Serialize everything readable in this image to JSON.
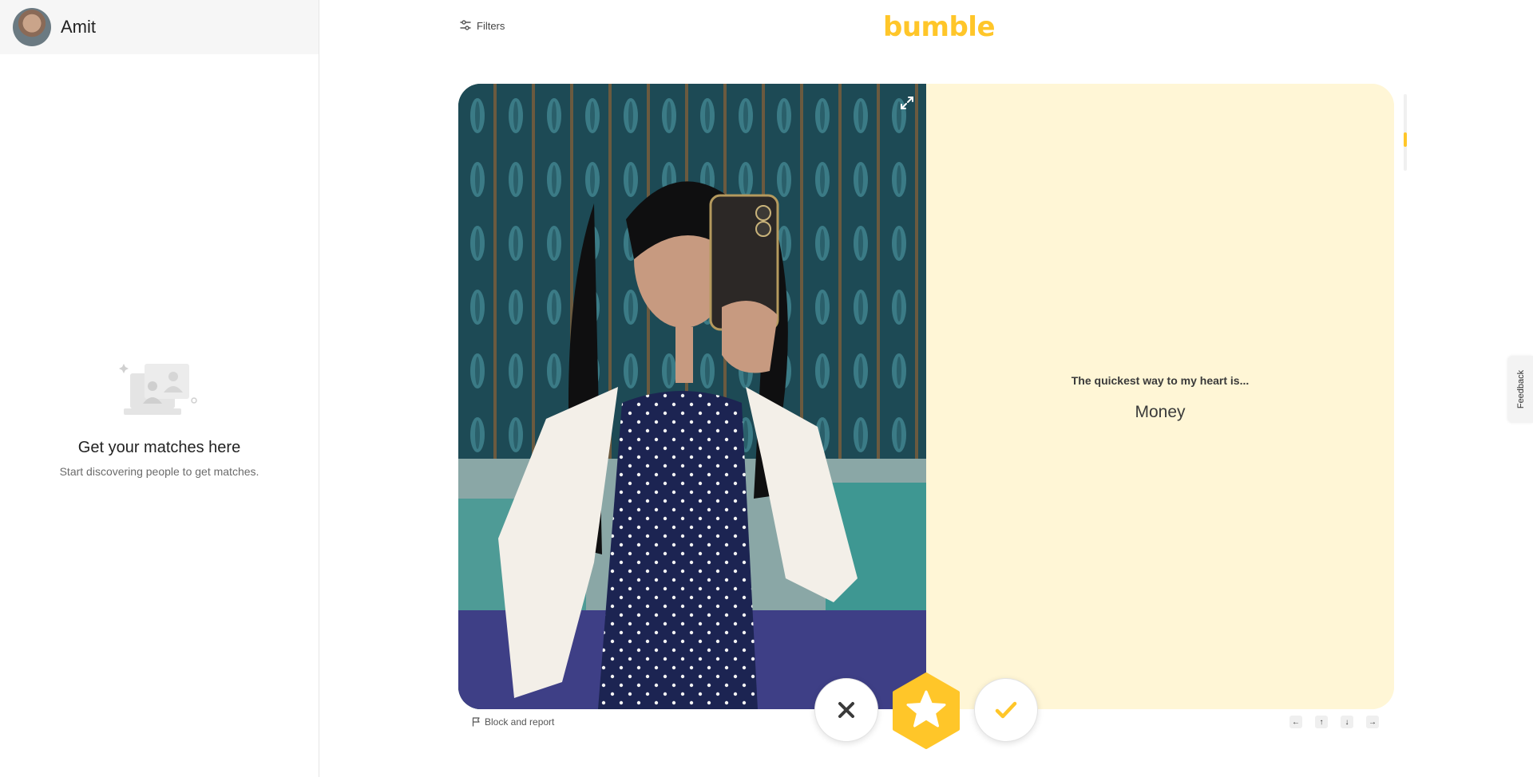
{
  "user": {
    "name": "Amit"
  },
  "empty_state": {
    "title": "Get your matches here",
    "subtitle": "Start discovering people to get matches."
  },
  "header": {
    "filters_label": "Filters",
    "logo_text": "bumble",
    "brand_color": "#ffc629"
  },
  "profile_card": {
    "prompt_question": "The quickest way to my heart is...",
    "prompt_answer": "Money",
    "panel_color": "#fff6d6"
  },
  "actions": {
    "pass_icon": "close-icon",
    "superswipe_icon": "star-icon",
    "like_icon": "check-icon"
  },
  "footer": {
    "block_report_label": "Block and report",
    "keyboard_hints": [
      "←",
      "↑",
      "↓",
      "→"
    ]
  },
  "feedback": {
    "label": "Feedback"
  }
}
